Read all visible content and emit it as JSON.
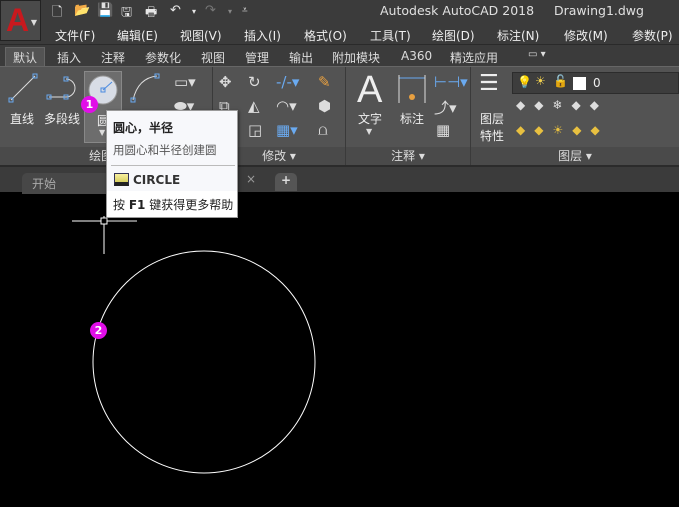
{
  "app": {
    "logo_letter": "A",
    "title": "Autodesk AutoCAD 2018",
    "document": "Drawing1.dwg"
  },
  "quick_access": [
    "new-icon",
    "open-icon",
    "save-icon",
    "saveas-icon",
    "plot-icon",
    "undo-icon",
    "redo-icon",
    "customize-icon"
  ],
  "menu": [
    "文件(F)",
    "编辑(E)",
    "视图(V)",
    "插入(I)",
    "格式(O)",
    "工具(T)",
    "绘图(D)",
    "标注(N)",
    "修改(M)",
    "参数(P)"
  ],
  "ribbon_tabs": [
    "默认",
    "插入",
    "注释",
    "参数化",
    "视图",
    "管理",
    "输出",
    "附加模块",
    "A360",
    "精选应用"
  ],
  "panels": {
    "draw": {
      "label": "绘图",
      "line": "直线",
      "polyline": "多段线",
      "circle": "圆"
    },
    "modify": {
      "label": "修改"
    },
    "annotation": {
      "label": "注释",
      "text": "文字",
      "dimension": "标注"
    },
    "layers": {
      "label": "图层",
      "properties_line1": "图层",
      "properties_line2": "特性",
      "current_layer": "0"
    }
  },
  "file_tabs": {
    "start": "开始",
    "close": "×",
    "add": "+"
  },
  "tooltip": {
    "title": "圆心，半径",
    "desc": "用圆心和半径创建圆",
    "command": "CIRCLE",
    "help_prefix": "按",
    "help_key": "F1",
    "help_suffix": "键获得更多帮助"
  },
  "markers": [
    "1",
    "2"
  ],
  "colors": {
    "marker": "#e10ee8",
    "logo": "#c8191e",
    "canvas": "#000000"
  }
}
